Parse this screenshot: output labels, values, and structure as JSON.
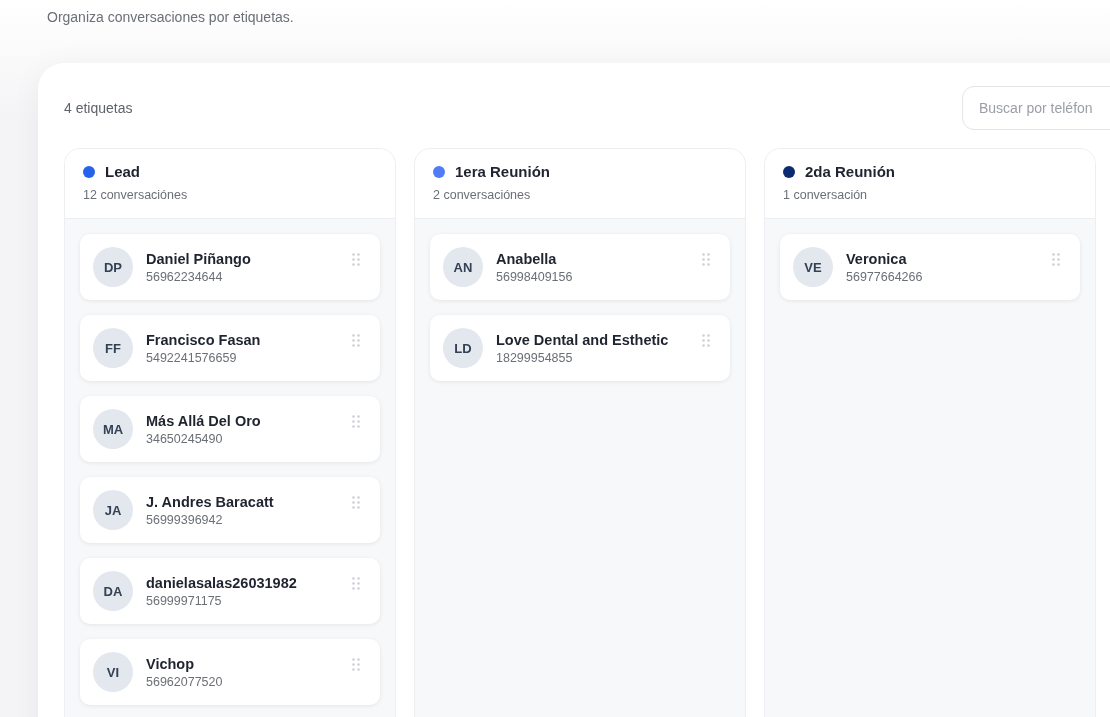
{
  "subtitle": "Organiza conversaciones por etiquetas.",
  "tag_count": "4 etiquetas",
  "search": {
    "placeholder": "Buscar por teléfon"
  },
  "columns": [
    {
      "title": "Lead",
      "color": "#2563eb",
      "count": "12 conversaciónes",
      "cards": [
        {
          "initials": "DP",
          "name": "Daniel Piñango",
          "phone": "56962234644"
        },
        {
          "initials": "FF",
          "name": "Francisco Fasan",
          "phone": "5492241576659"
        },
        {
          "initials": "MA",
          "name": "Más Allá Del Oro",
          "phone": "34650245490"
        },
        {
          "initials": "JA",
          "name": "J. Andres Baracatt",
          "phone": "56999396942"
        },
        {
          "initials": "DA",
          "name": "danielasalas26031982",
          "phone": "56999971175"
        },
        {
          "initials": "VI",
          "name": "Vichop",
          "phone": "56962077520"
        }
      ]
    },
    {
      "title": "1era Reunión",
      "color": "#4f7cf7",
      "count": "2 conversaciónes",
      "cards": [
        {
          "initials": "AN",
          "name": "Anabella",
          "phone": "56998409156"
        },
        {
          "initials": "LD",
          "name": "Love Dental and Esthetic",
          "phone": "18299954855"
        }
      ]
    },
    {
      "title": "2da Reunión",
      "color": "#0b2a6f",
      "count": "1 conversación",
      "cards": [
        {
          "initials": "VE",
          "name": "Veronica",
          "phone": "56977664266"
        }
      ]
    }
  ]
}
